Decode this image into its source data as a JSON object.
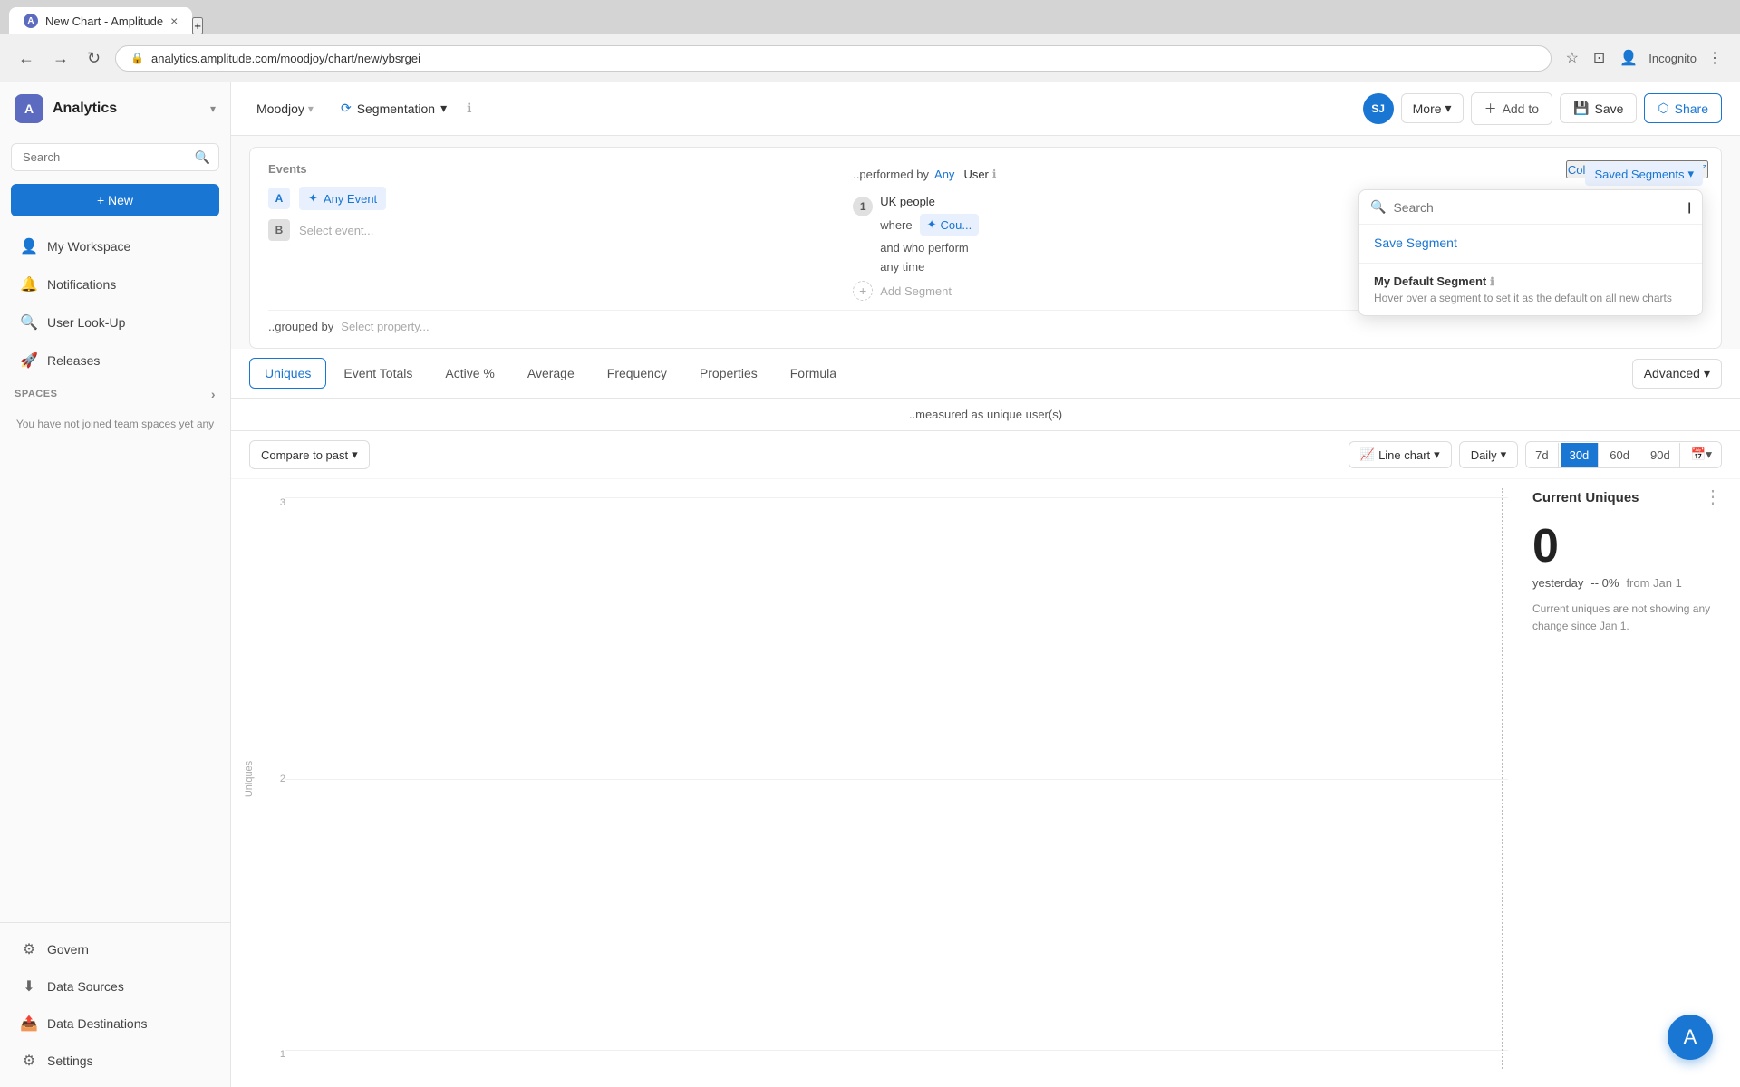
{
  "browser": {
    "tab_title": "New Chart - Amplitude",
    "tab_close": "×",
    "tab_new": "+",
    "nav_back": "←",
    "nav_forward": "→",
    "nav_refresh": "↻",
    "address": "analytics.amplitude.com/moodjoy/chart/new/ybsrgei",
    "incognito_label": "Incognito"
  },
  "sidebar": {
    "logo_letter": "A",
    "title": "Analytics",
    "search_placeholder": "Search",
    "new_button": "+ New",
    "nav_items": [
      {
        "id": "workspace",
        "label": "My Workspace",
        "icon": "👤"
      },
      {
        "id": "notifications",
        "label": "Notifications",
        "icon": "🔔"
      },
      {
        "id": "user-lookup",
        "label": "User Look-Up",
        "icon": "🔍"
      },
      {
        "id": "releases",
        "label": "Releases",
        "icon": "🚀"
      }
    ],
    "spaces_section": "SPACES",
    "spaces_msg": "You have not joined team spaces yet any",
    "bottom_items": [
      {
        "id": "govern",
        "label": "Govern",
        "icon": "⚙"
      },
      {
        "id": "data-sources",
        "label": "Data Sources",
        "icon": "⬇"
      },
      {
        "id": "data-destinations",
        "label": "Data Destinations",
        "icon": "📤"
      },
      {
        "id": "settings",
        "label": "Settings",
        "icon": "⚙"
      }
    ]
  },
  "topbar": {
    "project": "Moodjoy",
    "chart_type": "Segmentation",
    "info_icon": "ℹ",
    "avatar_letters": "SJ",
    "more_label": "More",
    "add_to_label": "Add to",
    "save_label": "Save",
    "share_label": "Share"
  },
  "chart_definition": {
    "collapse_label": "Collapse chart definition",
    "events_header": "Events",
    "event_a_label": "Any Event",
    "event_b_placeholder": "Select event...",
    "performed_by_label": "..performed by",
    "any_label": "Any",
    "user_label": "User",
    "saved_segments_label": "Saved Segments",
    "segment_1_label": "UK people",
    "where_label": "where",
    "count_label": "Cou...",
    "and_who_performs_label": "and who perform",
    "any_time_label": "any time",
    "add_segment_label": "Add Segment",
    "grouped_by_label": "..grouped by",
    "select_property_label": "Select property..."
  },
  "dropdown": {
    "search_placeholder": "Search",
    "save_segment_label": "Save Segment",
    "section_title": "My Default Segment",
    "section_sub": "Hover over a segment to set it as the default on all new charts"
  },
  "tabs": {
    "items": [
      {
        "id": "uniques",
        "label": "Uniques",
        "active": true
      },
      {
        "id": "event-totals",
        "label": "Event Totals",
        "active": false
      },
      {
        "id": "active-pct",
        "label": "Active %",
        "active": false
      },
      {
        "id": "average",
        "label": "Average",
        "active": false
      },
      {
        "id": "frequency",
        "label": "Frequency",
        "active": false
      },
      {
        "id": "properties",
        "label": "Properties",
        "active": false
      },
      {
        "id": "formula",
        "label": "Formula",
        "active": false
      }
    ],
    "advanced_label": "Advanced",
    "measured_as": "..measured as unique user(s)"
  },
  "chart_controls": {
    "compare_label": "Compare to past",
    "line_chart_label": "Line chart",
    "daily_label": "Daily",
    "dates": [
      {
        "id": "7d",
        "label": "7d"
      },
      {
        "id": "30d",
        "label": "30d",
        "active": true
      },
      {
        "id": "60d",
        "label": "60d"
      },
      {
        "id": "90d",
        "label": "90d"
      }
    ]
  },
  "chart": {
    "y_labels": [
      "3",
      "2",
      "1"
    ],
    "y_axis_title": "Uniques"
  },
  "stats": {
    "title": "Current Uniques",
    "value": "0",
    "pct": "-- 0%",
    "yesterday_label": "yesterday",
    "from_label": "from Jan 1",
    "description": "Current uniques are not showing any change since Jan 1."
  },
  "fab": {
    "icon": "A"
  }
}
